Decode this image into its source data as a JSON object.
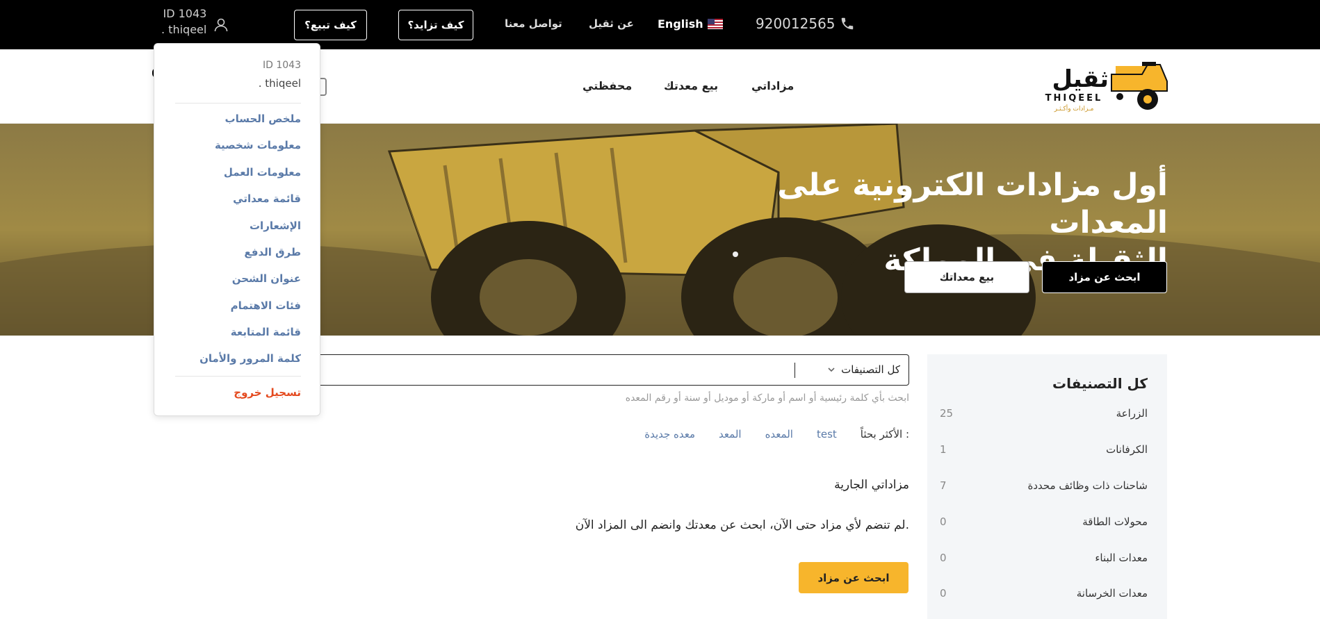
{
  "topbar": {
    "phone": "920012565",
    "language": "English",
    "links": [
      "تواصل معنا",
      "عن ثقيل"
    ],
    "how_bid": "كيف تزايد؟",
    "how_sell": "كيف تبيع؟",
    "user_id": "ID 1043",
    "user_name": ". thiqeel"
  },
  "nav": {
    "logo_ar": "ثقيل",
    "logo_en": "THIQEEL",
    "logo_tag": "مـزادات وأكـثـر",
    "items": [
      "مزاداتي",
      "بيع معدتك",
      "محفظتي"
    ]
  },
  "hero": {
    "title_line1": "أول مزادات الكترونية على المعدات",
    "title_line2": "الثقيلة في المملكة",
    "btn_search": "ابحث عن مزاد",
    "btn_sell": "بيع معداتك"
  },
  "categories": {
    "title": "كل التصنيفات",
    "items": [
      {
        "name": "الزراعة",
        "count": "25"
      },
      {
        "name": "الكرفانات",
        "count": "1"
      },
      {
        "name": "شاحنات ذات وظائف محددة",
        "count": "7"
      },
      {
        "name": "محولات الطاقة",
        "count": "0"
      },
      {
        "name": "معدات البناء",
        "count": "0"
      },
      {
        "name": "معدات الخرسانة",
        "count": "0"
      }
    ]
  },
  "search": {
    "category": "كل التصنيفات",
    "hint": "ابحث بأي كلمة رئيسية أو اسم أو ماركة أو موديل أو سنة أو رقم المعده",
    "tags_label": "الأكثر بحثاً :",
    "tags": [
      "test",
      "المعده",
      "المعد",
      "معده جديدة"
    ]
  },
  "main": {
    "section_title": "مزاداتي الجارية",
    "empty_message": "لم تنضم لأي مزاد حتى الآن، ابحث عن معدتك وانضم الى المزاد الآن.",
    "find_button": "ابحث عن مزاد"
  },
  "dropdown": {
    "id": "ID 1043",
    "user": ". thiqeel",
    "items": [
      "ملخص الحساب",
      "معلومات شخصية",
      "معلومات العمل",
      "قائمة معداتي",
      "الإشعارات",
      "طرق الدفع",
      "عنوان الشحن",
      "فئات الاهتمام",
      "قائمة المتابعة",
      "كلمة المرور والأمان"
    ],
    "logout": "تسجيل خروج"
  },
  "colors": {
    "accent": "#f7b52c",
    "link": "#5a7aa8",
    "logout": "#e44a1f"
  }
}
